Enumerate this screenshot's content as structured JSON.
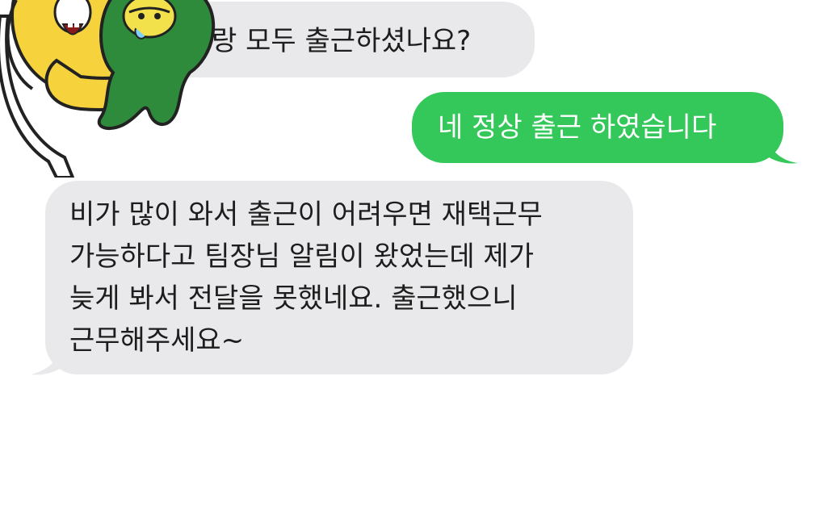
{
  "conversation": {
    "messages": [
      {
        "direction": "received",
        "text": "랑 모두 출근하셨나요?"
      },
      {
        "direction": "sent",
        "text": "네 정상 출근 하였습니다"
      },
      {
        "direction": "received",
        "text": "비가 많이 와서 출근이 어려우면 재택근무\n가능하다고 팀장님 알림이 왔었는데 제가\n늦게 봐서 전달을 못했네요. 출근했으니\n근무해주세요~"
      }
    ],
    "sticker_icon": "kakao-ryan-hugging-character-sticker"
  },
  "colors": {
    "received_bubble": "#e9e9eb",
    "sent_bubble": "#34c759",
    "received_text": "#1d1d1d",
    "sent_text": "#ffffff",
    "background": "#ffffff"
  }
}
